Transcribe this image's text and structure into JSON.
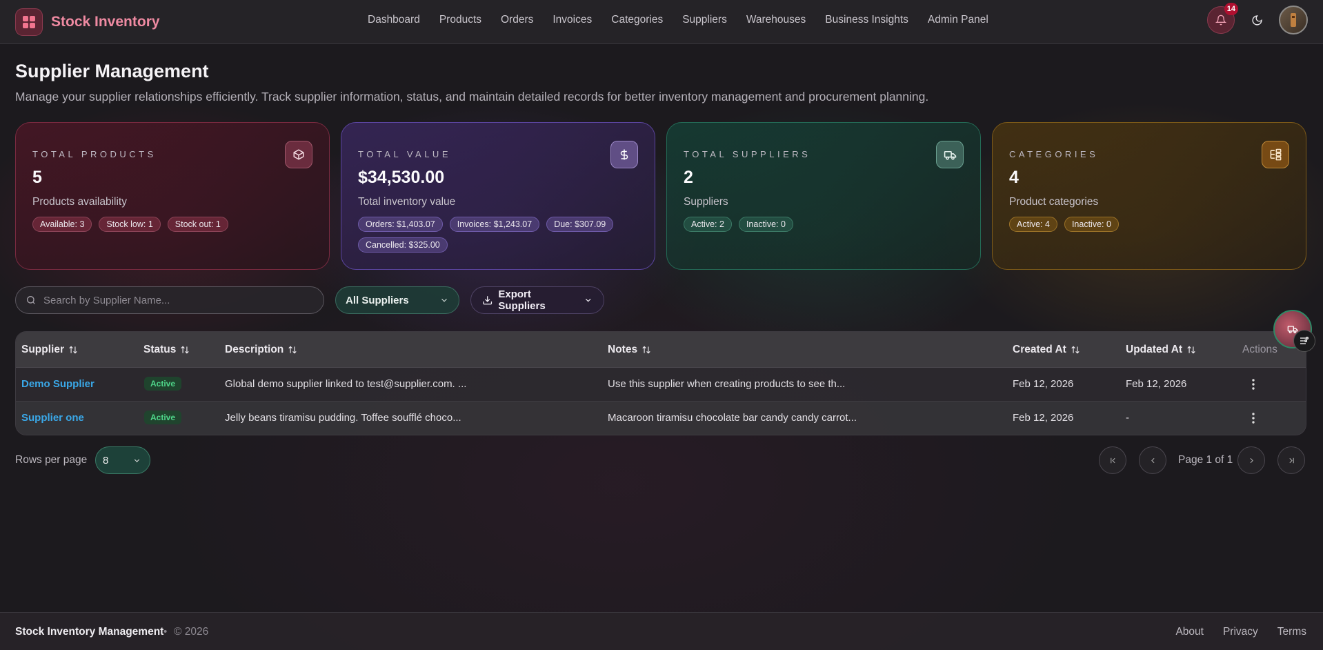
{
  "app": {
    "title": "Stock Inventory"
  },
  "nav": {
    "items": [
      "Dashboard",
      "Products",
      "Orders",
      "Invoices",
      "Categories",
      "Suppliers",
      "Warehouses",
      "Business Insights",
      "Admin Panel"
    ]
  },
  "notifications": {
    "count": "14"
  },
  "page": {
    "title": "Supplier Management",
    "subtitle": "Manage your supplier relationships efficiently. Track supplier information, status, and maintain detailed records for better inventory management and procurement planning."
  },
  "cards": [
    {
      "label": "TOTAL PRODUCTS",
      "value": "5",
      "desc": "Products availability",
      "chips": [
        "Available: 3",
        "Stock low: 1",
        "Stock out: 1"
      ],
      "icon": "box-icon"
    },
    {
      "label": "TOTAL VALUE",
      "value": "$34,530.00",
      "desc": "Total inventory value",
      "chips": [
        "Orders: $1,403.07",
        "Invoices: $1,243.07",
        "Due: $307.09",
        "Cancelled: $325.00"
      ],
      "icon": "dollar-icon"
    },
    {
      "label": "TOTAL SUPPLIERS",
      "value": "2",
      "desc": "Suppliers",
      "chips": [
        "Active: 2",
        "Inactive: 0"
      ],
      "icon": "truck-icon"
    },
    {
      "label": "CATEGORIES",
      "value": "4",
      "desc": "Product categories",
      "chips": [
        "Active: 4",
        "Inactive: 0"
      ],
      "icon": "category-tree-icon"
    }
  ],
  "toolbar": {
    "search_placeholder": "Search by Supplier Name...",
    "filter_value": "All Suppliers",
    "export_label": "Export Suppliers"
  },
  "table": {
    "headers": {
      "supplier": "Supplier",
      "status": "Status",
      "description": "Description",
      "notes": "Notes",
      "created": "Created At",
      "updated": "Updated At",
      "actions": "Actions"
    },
    "rows": [
      {
        "supplier": "Demo Supplier",
        "status": "Active",
        "description": "Global demo supplier linked to test@supplier.com. ...",
        "notes": "Use this supplier when creating products to see th...",
        "created": "Feb 12, 2026",
        "updated": "Feb 12, 2026"
      },
      {
        "supplier": "Supplier one",
        "status": "Active",
        "description": "Jelly beans tiramisu pudding. Toffee soufflé choco...",
        "notes": "Macaroon tiramisu chocolate bar candy candy carrot...",
        "created": "Feb 12, 2026",
        "updated": "-"
      }
    ]
  },
  "pagination": {
    "rows_label": "Rows per page",
    "rows_value": "8",
    "page_text": "Page 1 of 1"
  },
  "footer": {
    "brand": "Stock Inventory Management",
    "dot": "•",
    "copyright": "© 2026",
    "links": [
      "About",
      "Privacy",
      "Terms"
    ]
  }
}
